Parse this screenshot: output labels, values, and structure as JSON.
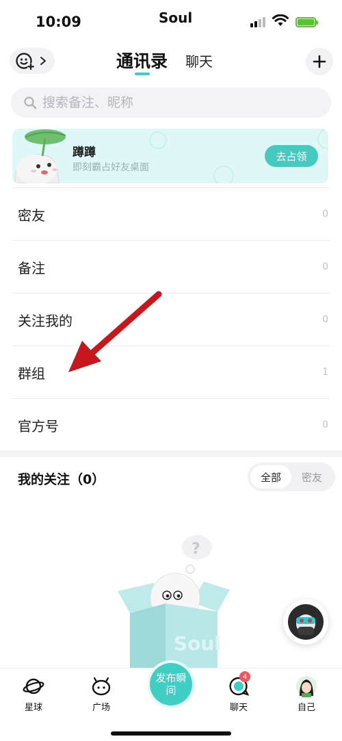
{
  "status_bar": {
    "time": "10:09",
    "app_name": "Soul"
  },
  "top_nav": {
    "tabs": [
      {
        "label": "通讯录",
        "active": true
      },
      {
        "label": "聊天",
        "active": false
      }
    ],
    "mood_icon": "smiley-add-icon",
    "plus_icon": "plus-icon"
  },
  "search": {
    "placeholder": "搜索备注、昵称",
    "value": ""
  },
  "banner": {
    "title": "蹲蹲",
    "subtitle": "即刻霸占好友桌面",
    "button": "去占领"
  },
  "contact_groups": [
    {
      "label": "密友",
      "count": "0"
    },
    {
      "label": "备注",
      "count": "0"
    },
    {
      "label": "关注我的",
      "count": "0"
    },
    {
      "label": "群组",
      "count": "1"
    },
    {
      "label": "官方号",
      "count": "0"
    }
  ],
  "follow_section": {
    "title": "我的关注（0）",
    "filters": [
      "全部",
      "密友"
    ],
    "selected_filter": "全部",
    "illustration_text": "Soul"
  },
  "bottom_tabs": {
    "planet": "星球",
    "square": "广场",
    "publish": "发布瞬间",
    "chat": "聊天",
    "chat_badge": "4",
    "me": "自己"
  },
  "colors": {
    "accent": "#3fcfc4",
    "banner_bg": "#dff7f7",
    "badge": "#f0575f",
    "annotation_arrow": "#c8171c"
  }
}
